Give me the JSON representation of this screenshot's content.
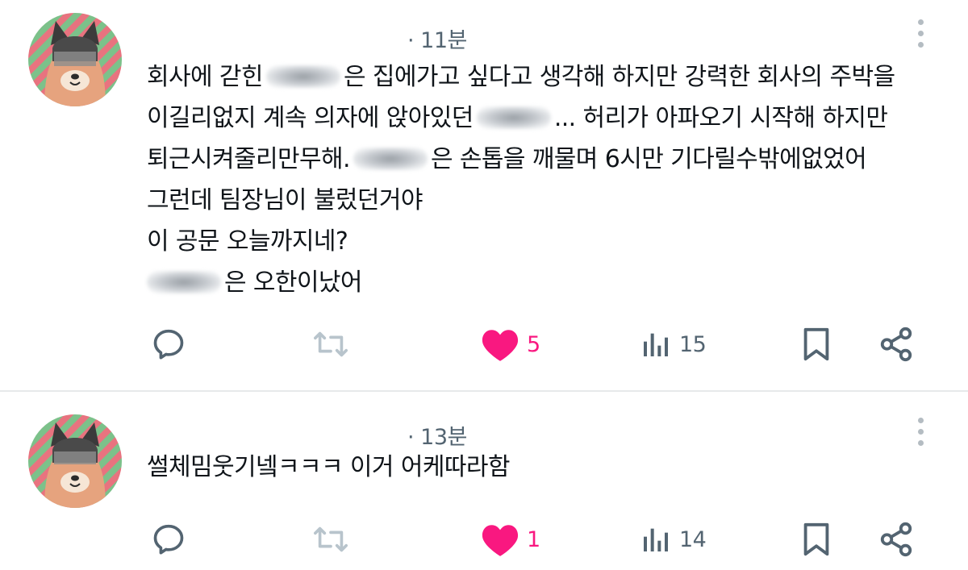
{
  "posts": [
    {
      "time": "· 11분",
      "lines": [
        [
          "회사에 갇힌",
          "은 집에가고 싶다고 생각해 하지만 강력한 회사의 주박을"
        ],
        [
          "이길리없지 계속 의자에 앉아있던",
          "... 허리가 아파오기 시작해 하지만"
        ],
        [
          "퇴근시켜줄리만무해.",
          "은 손톱을 깨물며 6시만 기다릴수밖에없었어"
        ],
        [
          "그런데 팀장님이 불렀던거야"
        ],
        [
          "이 공문 오늘까지네?"
        ],
        [
          "",
          "은 오한이났어"
        ]
      ],
      "likes": "5",
      "views": "15"
    },
    {
      "time": "· 13분",
      "lines": [
        [
          "썰체밈웃기넼ㅋㅋㅋ 이거 어케따라함"
        ]
      ],
      "likes": "1",
      "views": "14"
    }
  ],
  "icons": {
    "reply": "reply-icon",
    "retweet": "retweet-icon",
    "like": "heart-icon",
    "views": "views-icon",
    "bookmark": "bookmark-icon",
    "share": "share-icon",
    "more": "more-icon"
  },
  "colors": {
    "like": "#f91880",
    "muted": "#536471",
    "divider": "#e7e9ea",
    "retweet_inactive": "#b8c4cc"
  }
}
